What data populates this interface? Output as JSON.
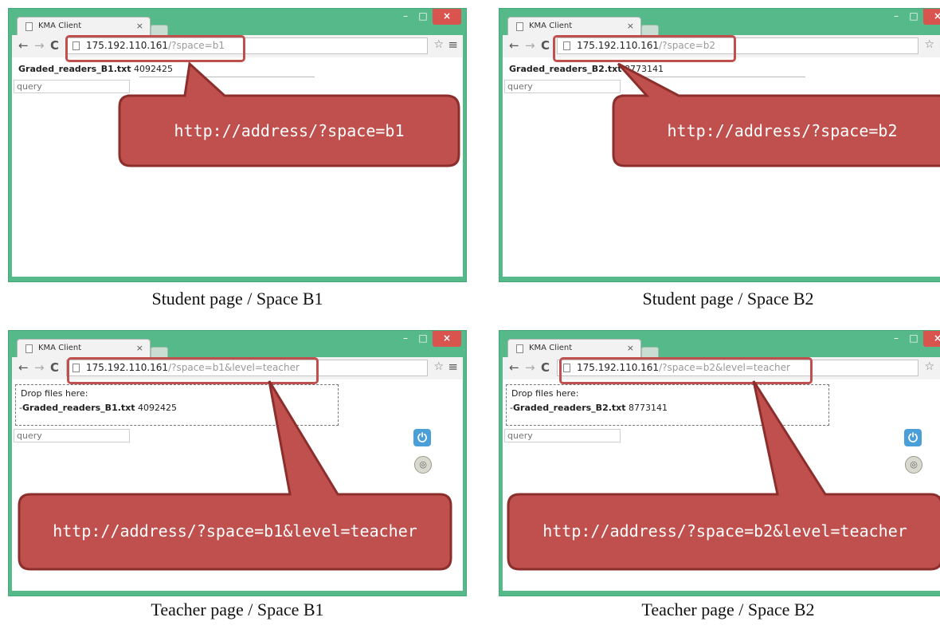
{
  "panels": [
    {
      "tab_title": "KMA Client",
      "url_host": "175.192.110.161",
      "url_rest": "/?space=b1",
      "file_name": "Graded_readers_B1.txt",
      "file_size": "4092425",
      "query_placeholder": "query",
      "callout": "http://address/?space=b1",
      "caption": "Student page / Space B1"
    },
    {
      "tab_title": "KMA Client",
      "url_host": "175.192.110.161",
      "url_rest": "/?space=b2",
      "file_name": "Graded_readers_B2.txt",
      "file_size": "8773141",
      "query_placeholder": "query",
      "callout": "http://address/?space=b2",
      "caption": "Student page / Space B2"
    },
    {
      "tab_title": "KMA Client",
      "url_host": "175.192.110.161",
      "url_rest": "/?space=b1&level=teacher",
      "drop_title": "Drop files here:",
      "file_name": "Graded_readers_B1.txt",
      "file_size": "4092425",
      "query_placeholder": "query",
      "callout": "http://address/?space=b1&level=teacher",
      "caption": "Teacher page / Space B1"
    },
    {
      "tab_title": "KMA Client",
      "url_host": "175.192.110.161",
      "url_rest": "/?space=b2&level=teacher",
      "drop_title": "Drop files here:",
      "file_name": "Graded_readers_B2.txt",
      "file_size": "8773141",
      "query_placeholder": "query",
      "callout": "http://address/?space=b2&level=teacher",
      "caption": "Teacher page / Space B2"
    }
  ],
  "icons": {
    "tab_close": "×",
    "window_minimize": "–",
    "window_maximize": "□",
    "window_close": "×",
    "back": "←",
    "forward": "→",
    "reload": "C",
    "star": "☆",
    "menu": "≡",
    "power": "⏻",
    "sync": "◎"
  },
  "colors": {
    "window_frame": "#56b98a",
    "callout_fill": "#c0504d",
    "callout_border": "#8c2f2c",
    "highlight_border": "#c0504d",
    "window_close": "#d9534f",
    "power_button": "#4a9fd8"
  }
}
